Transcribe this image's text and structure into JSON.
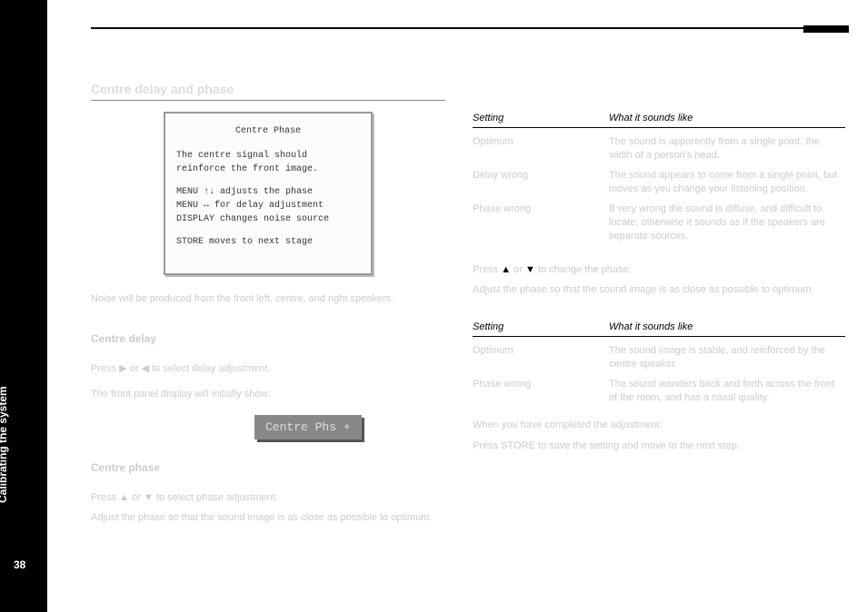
{
  "sidebar": {
    "section_title": "Calibrating the system",
    "page_number": "38"
  },
  "left": {
    "heading_faint": "Centre delay and phase",
    "screenshot": {
      "title": "Centre Phase",
      "line1": "The centre signal should",
      "line2": "reinforce the front image.",
      "line3": "MENU ↑↓ adjusts the phase",
      "line4": "MENU ↔ for delay adjustment",
      "line5": "DISPLAY changes noise source",
      "line6": "STORE moves to next stage"
    },
    "para1_faint": "Noise will be produced from the front left, centre, and right speakers.",
    "centre_delay_title": "Centre delay",
    "centre_delay_body_1": "Press ",
    "centre_delay_body_2": " or ",
    "centre_delay_body_3": " to select delay adjustment.",
    "display_label_intro": "The front panel display will initially show:",
    "display_value": "Centre Phs +",
    "centre_phase_title": "Centre phase",
    "centre_phase_body_1": "Press ",
    "centre_phase_body_2": " or ",
    "centre_phase_body_3": " to select phase adjustment.",
    "centre_phase_body_4": "Adjust the phase so that the sound image is as close as possible to optimum."
  },
  "right": {
    "table1": {
      "h1": "Setting",
      "h2": "What it sounds like",
      "rows": [
        {
          "c1": "Optimum",
          "c2": "The sound is apparently from a single point, the width of a person's head."
        },
        {
          "c1": "Delay wrong",
          "c2": "The sound appears to come from a single point, but moves as you change your listening position."
        },
        {
          "c1": "Phase wrong",
          "c2": "If very wrong the sound is diffuse, and difficult to locate; otherwise it sounds as if the speakers are separate sources."
        }
      ]
    },
    "between": {
      "p1a": "Press ",
      "p1m": " or ",
      "p1b": " to change the phase.",
      "p2": "Adjust the phase so that the sound image is as close as possible to optimum."
    },
    "table2": {
      "h1": "Setting",
      "h2": "What it sounds like",
      "rows": [
        {
          "c1": "Optimum",
          "c2": "The sound image is stable, and reinforced by the centre speaker."
        },
        {
          "c1": "Phase wrong",
          "c2": "The sound wanders back and forth across the front of the room, and has a nasal quality."
        }
      ]
    },
    "store": {
      "p1": "When you have completed the adjustment:",
      "p2": "Press STORE to save the setting and move to the next step."
    }
  }
}
